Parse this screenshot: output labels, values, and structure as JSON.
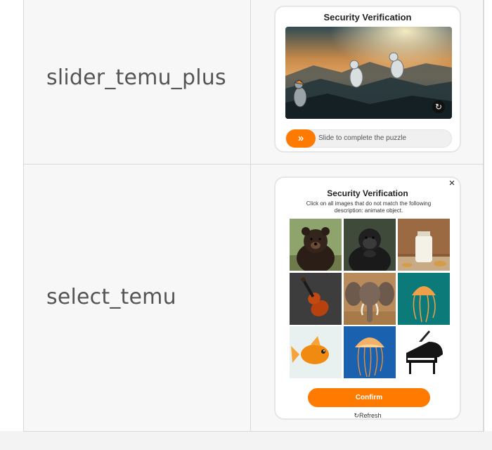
{
  "rows": [
    {
      "label": "slider_temu_plus"
    },
    {
      "label": "select_temu"
    }
  ],
  "slider_captcha": {
    "title": "Security Verification",
    "slider_text": "Slide to complete the puzzle",
    "handle_icon": "double-chevron-right-icon",
    "handle_glyph": "»",
    "refresh_icon": "refresh-icon",
    "refresh_glyph": "↻",
    "accent_color": "#ff7a00"
  },
  "select_captcha": {
    "title": "Security Verification",
    "description_line1": "Click on all images that do not match the following",
    "description_line2": "description: animate object.",
    "close_glyph": "×",
    "tiles": [
      {
        "subject": "bear"
      },
      {
        "subject": "gorilla"
      },
      {
        "subject": "milk-bottle"
      },
      {
        "subject": "violin"
      },
      {
        "subject": "elephant"
      },
      {
        "subject": "jellyfish"
      },
      {
        "subject": "goldfish"
      },
      {
        "subject": "jellyfish"
      },
      {
        "subject": "grand-piano"
      }
    ],
    "confirm_label": "Confirm",
    "refresh_label": "Refresh",
    "refresh_glyph": "↻",
    "accent_color": "#ff7a00"
  }
}
